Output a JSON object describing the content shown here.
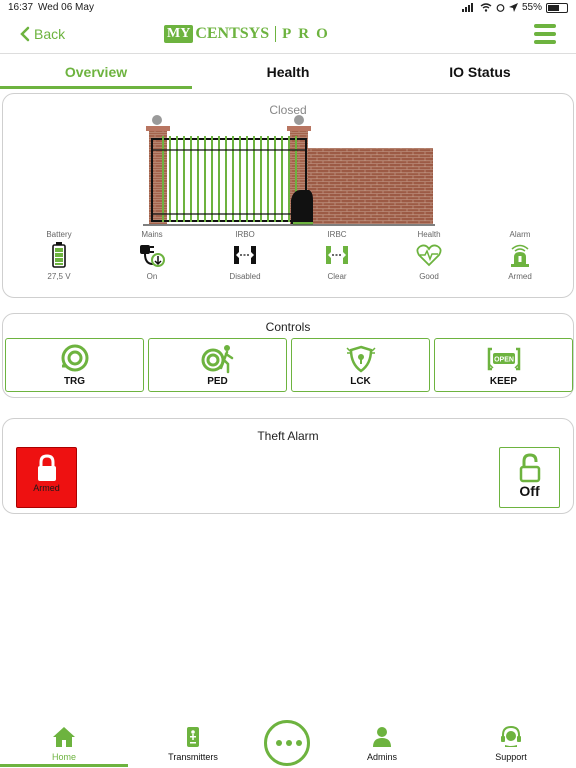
{
  "status_bar": {
    "time": "16:37",
    "date": "Wed 06 May",
    "battery": "55%"
  },
  "nav": {
    "back_label": "Back",
    "logo": {
      "my": "MY",
      "centsys": "CENTSYS",
      "pro": "PRO"
    }
  },
  "tabs": [
    {
      "label": "Overview",
      "active": true
    },
    {
      "label": "Health"
    },
    {
      "label": "IO Status"
    }
  ],
  "gate": {
    "state": "Closed"
  },
  "metrics": [
    {
      "label": "Battery",
      "value": "27,5 V",
      "icon": "battery-icon"
    },
    {
      "label": "Mains",
      "value": "On",
      "icon": "mains-plug-icon"
    },
    {
      "label": "IRBO",
      "value": "Disabled",
      "icon": "irbo-beam-icon"
    },
    {
      "label": "IRBC",
      "value": "Clear",
      "icon": "irbc-beam-icon"
    },
    {
      "label": "Health",
      "value": "Good",
      "icon": "heart-pulse-icon"
    },
    {
      "label": "Alarm",
      "value": "Armed",
      "icon": "siren-icon"
    }
  ],
  "controls": {
    "title": "Controls",
    "buttons": [
      {
        "label": "TRG",
        "icon": "trigger-icon"
      },
      {
        "label": "PED",
        "icon": "pedestrian-icon"
      },
      {
        "label": "LCK",
        "icon": "lock-gate-icon"
      },
      {
        "label": "KEEP",
        "icon": "keep-open-icon"
      }
    ]
  },
  "theft_alarm": {
    "title": "Theft Alarm",
    "armed_label": "Armed",
    "off_label": "Off"
  },
  "bottom_nav": [
    {
      "label": "Home",
      "icon": "home-icon",
      "active": true
    },
    {
      "label": "Transmitters",
      "icon": "remote-icon"
    },
    {
      "label": "",
      "icon": "more-icon"
    },
    {
      "label": "Admins",
      "icon": "person-icon"
    },
    {
      "label": "Support",
      "icon": "headset-icon"
    }
  ],
  "colors": {
    "accent": "#6db33f",
    "alarm_red": "#ee1111",
    "brick": "#9c5a45"
  }
}
